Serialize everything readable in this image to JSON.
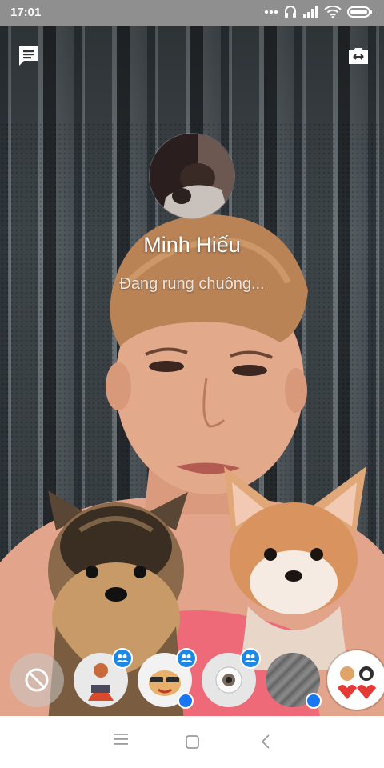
{
  "status_bar": {
    "time": "17:01",
    "icons": [
      "more-dots-icon",
      "headset-icon",
      "signal-icon",
      "wifi-icon",
      "battery-icon"
    ]
  },
  "top_controls": {
    "left": "chat-icon",
    "right": "switch-camera-icon"
  },
  "call": {
    "caller_name": "Minh Hiếu",
    "status": "Đang rung chuông..."
  },
  "effects": {
    "items": [
      {
        "name": "none",
        "icon": "no-effect-icon",
        "group_badge": false,
        "selected": false
      },
      {
        "name": "sticker-person",
        "icon": "avatar-sticker-icon",
        "group_badge": true,
        "selected": false
      },
      {
        "name": "dog-sunglasses",
        "icon": "dog-sunglasses-icon",
        "group_badge": true,
        "selected": false
      },
      {
        "name": "eyeball",
        "icon": "eyeball-icon",
        "group_badge": true,
        "selected": false
      },
      {
        "name": "glass-filter",
        "icon": "filter-icon",
        "group_badge": false,
        "selected": false
      },
      {
        "name": "dogs-hearts",
        "icon": "dogs-hearts-icon",
        "group_badge": false,
        "selected": true
      }
    ],
    "badge_color": "#1e88e5"
  },
  "nav_bar": {
    "items": [
      "menu-icon",
      "home-icon",
      "back-icon"
    ]
  }
}
